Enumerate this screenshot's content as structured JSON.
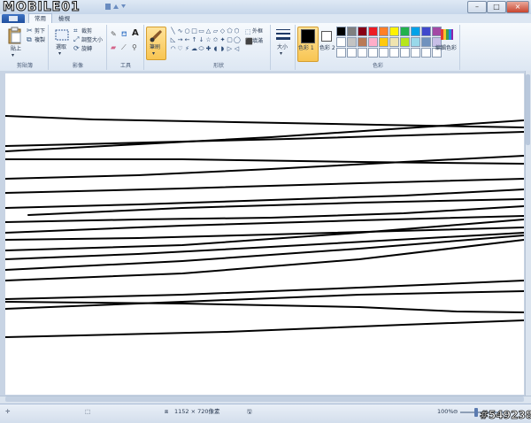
{
  "window": {
    "logo_text": "MOBILE01",
    "controls": {
      "minimize": "–",
      "maximize": "□",
      "close": "×"
    }
  },
  "tabs": [
    {
      "label": "常用",
      "active": true
    },
    {
      "label": "檢視",
      "active": false
    }
  ],
  "ribbon": {
    "clipboard": {
      "group_label": "剪貼簿",
      "paste_label": "貼上",
      "cut_label": "剪下",
      "copy_label": "複製"
    },
    "image": {
      "group_label": "影像",
      "select_label": "選取",
      "crop_label": "裁剪",
      "resize_label": "調整大小",
      "rotate_label": "旋轉"
    },
    "tools": {
      "group_label": "工具"
    },
    "brushes": {
      "label": "筆刷"
    },
    "shapes": {
      "group_label": "形狀",
      "outline_label": "外框",
      "fill_label": "填滿",
      "glyphs": [
        "╲",
        "∿",
        "○",
        "□",
        "▭",
        "△",
        "▱",
        "◇",
        "⬠",
        "⬡",
        "◺",
        "→",
        "←",
        "↑",
        "↓",
        "☆",
        "✩",
        "✦",
        "▢",
        "◯",
        "◠",
        "♡",
        "⚡",
        "☁",
        "⬭",
        "✚",
        "◖",
        "◗",
        "▷",
        "◁"
      ]
    },
    "size": {
      "label": "大小"
    },
    "colors": {
      "group_label": "色彩",
      "color1_label": "色彩 1",
      "color2_label": "色彩 2",
      "edit_label": "編輯色彩",
      "color1": "#000000",
      "color2": "#ffffff",
      "palette": [
        "#000000",
        "#7f7f7f",
        "#880015",
        "#ed1c24",
        "#ff7f27",
        "#fff200",
        "#22b14c",
        "#00a2e8",
        "#3f48cc",
        "#a349a4",
        "#ffffff",
        "#c3c3c3",
        "#b97a57",
        "#ffaec9",
        "#ffc90e",
        "#efe4b0",
        "#b5e61d",
        "#99d9ea",
        "#7092be",
        "#c8bfe7",
        "#ffffff",
        "#ffffff",
        "#ffffff",
        "#ffffff",
        "#ffffff",
        "#ffffff",
        "#ffffff",
        "#ffffff",
        "#ffffff",
        "#ffffff"
      ]
    }
  },
  "status": {
    "dimensions": "1152 × 720像素",
    "zoom": "100%",
    "watermark": "#549238"
  }
}
